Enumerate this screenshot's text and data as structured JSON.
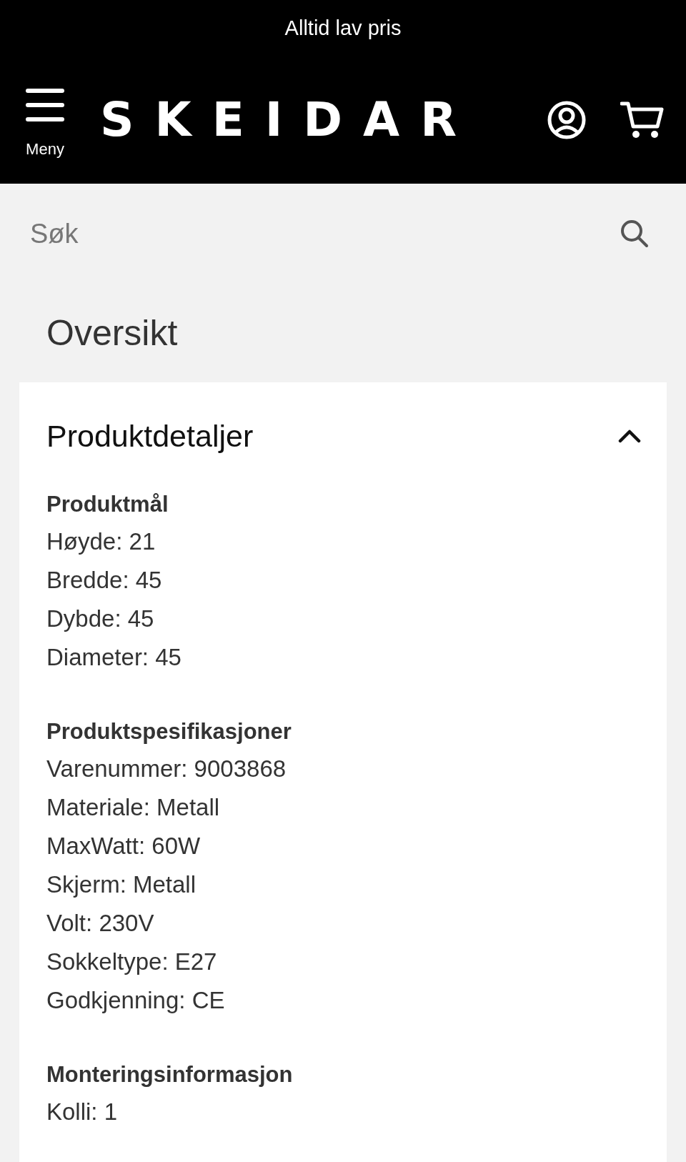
{
  "top_banner": {
    "text": "Alltid lav pris"
  },
  "header": {
    "menu_label": "Meny",
    "logo": "SKEIDAR"
  },
  "search": {
    "placeholder": "Søk"
  },
  "page_title": "Oversikt",
  "accordion": {
    "title": "Produktdetaljer",
    "expanded": true,
    "sections": [
      {
        "heading": "Produktmål",
        "lines": [
          "Høyde: 21",
          "Bredde: 45",
          "Dybde: 45",
          "Diameter: 45"
        ]
      },
      {
        "heading": "Produktspesifikasjoner",
        "lines": [
          "Varenummer: 9003868",
          "Materiale: Metall",
          "MaxWatt: 60W",
          "Skjerm: Metall",
          "Volt: 230V",
          "Sokkeltype: E27",
          "Godkjenning: CE"
        ]
      },
      {
        "heading": "Monteringsinformasjon",
        "lines": [
          "Kolli: 1"
        ]
      }
    ]
  }
}
